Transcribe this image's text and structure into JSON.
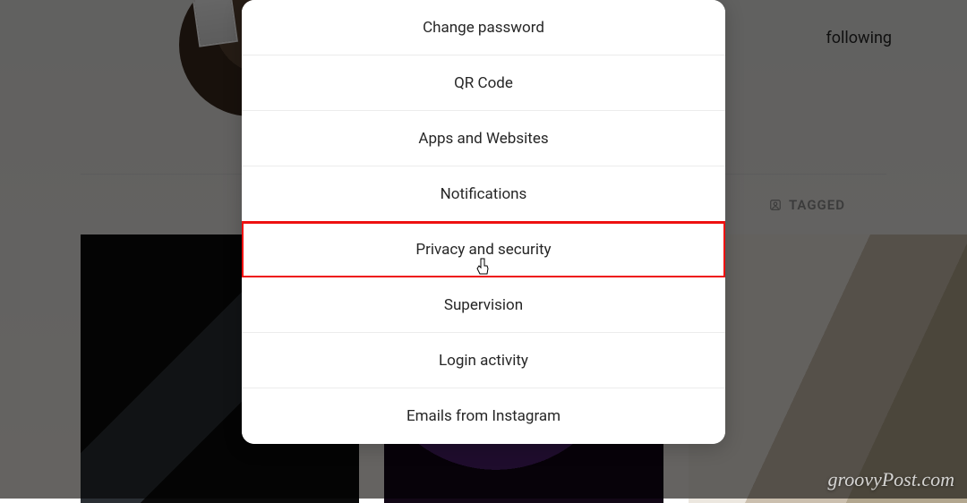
{
  "background": {
    "following_text": "following",
    "tagged_label": "TAGGED"
  },
  "modal": {
    "items": [
      {
        "id": "change-password",
        "label": "Change password"
      },
      {
        "id": "qr-code",
        "label": "QR Code"
      },
      {
        "id": "apps-websites",
        "label": "Apps and Websites"
      },
      {
        "id": "notifications",
        "label": "Notifications"
      },
      {
        "id": "privacy-security",
        "label": "Privacy and security",
        "highlighted": true,
        "cursor": true
      },
      {
        "id": "supervision",
        "label": "Supervision"
      },
      {
        "id": "login-activity",
        "label": "Login activity"
      },
      {
        "id": "emails-instagram",
        "label": "Emails from Instagram"
      }
    ]
  },
  "watermark": "groovyPost.com"
}
